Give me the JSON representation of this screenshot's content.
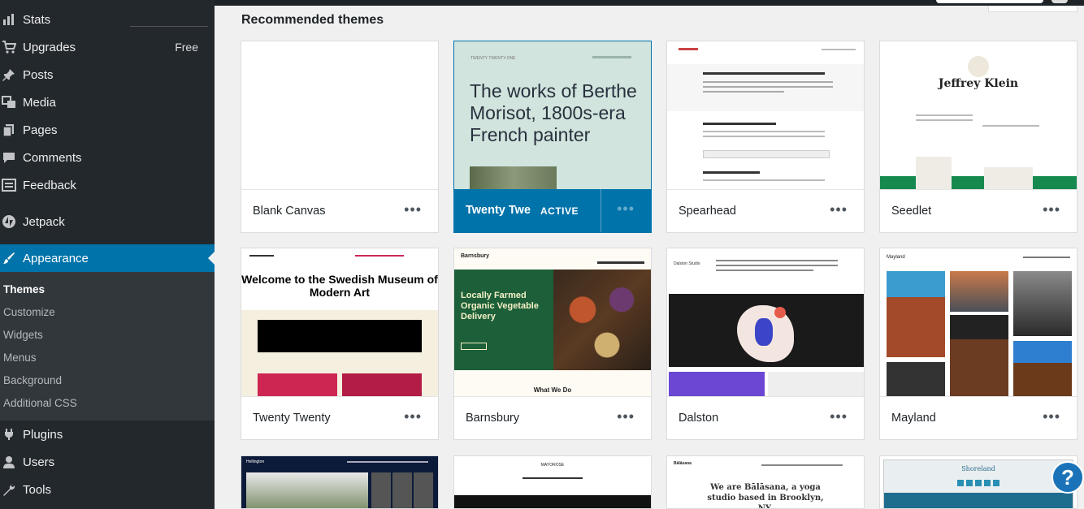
{
  "sidebar": {
    "items": [
      {
        "label": "Stats",
        "icon": "stats-icon"
      },
      {
        "label": "Upgrades",
        "badge": "Free",
        "icon": "cart-icon"
      },
      {
        "label": "Posts",
        "icon": "pin-icon"
      },
      {
        "label": "Media",
        "icon": "media-icon"
      },
      {
        "label": "Pages",
        "icon": "pages-icon"
      },
      {
        "label": "Comments",
        "icon": "comments-icon"
      },
      {
        "label": "Feedback",
        "icon": "feedback-icon"
      },
      {
        "label": "Jetpack",
        "icon": "jetpack-icon"
      },
      {
        "label": "Appearance",
        "icon": "appearance-icon"
      },
      {
        "label": "Plugins",
        "icon": "plugins-icon"
      },
      {
        "label": "Users",
        "icon": "users-icon"
      },
      {
        "label": "Tools",
        "icon": "tools-icon"
      }
    ],
    "submenu": [
      "Themes",
      "Customize",
      "Widgets",
      "Menus",
      "Background",
      "Additional CSS"
    ]
  },
  "main": {
    "title": "Recommended themes",
    "themes": [
      {
        "name": "Blank Canvas"
      },
      {
        "name": "Twenty Twenty-One",
        "status": "ACTIVE"
      },
      {
        "name": "Spearhead"
      },
      {
        "name": "Seedlet"
      },
      {
        "name": "Twenty Twenty"
      },
      {
        "name": "Barnsbury"
      },
      {
        "name": "Dalston"
      },
      {
        "name": "Mayland"
      }
    ],
    "more_label": "•••"
  },
  "previews": {
    "tt1_headline": "The works of Berthe Morisot, 1800s-era French painter",
    "tt1_site": "TWENTY TWENTY-ONE",
    "seedlet_name": "Jeffrey Klein",
    "tt_headline": "Welcome to the Swedish Museum of Modern Art",
    "barnsbury_brand": "Barnsbury",
    "barnsbury_headline": "Locally Farmed Organic Vegetable Delivery",
    "barnsbury_next": "What We Do",
    "dalston_brand": "Dalston Studio",
    "mayland_brand": "Mayland",
    "balasana_brand": "Bālāsana",
    "balasana_headline": "We are Bālāsana, a yoga studio based in Brooklyn, NY.",
    "row3a_brand": "Hellington",
    "row3b_brand": "MAYOROSE",
    "row3d_brand": "Shoreland"
  },
  "help": {
    "label": "?"
  },
  "colors": {
    "sidebar": "#23282d",
    "active": "#0073aa",
    "submenu": "#32373c"
  }
}
